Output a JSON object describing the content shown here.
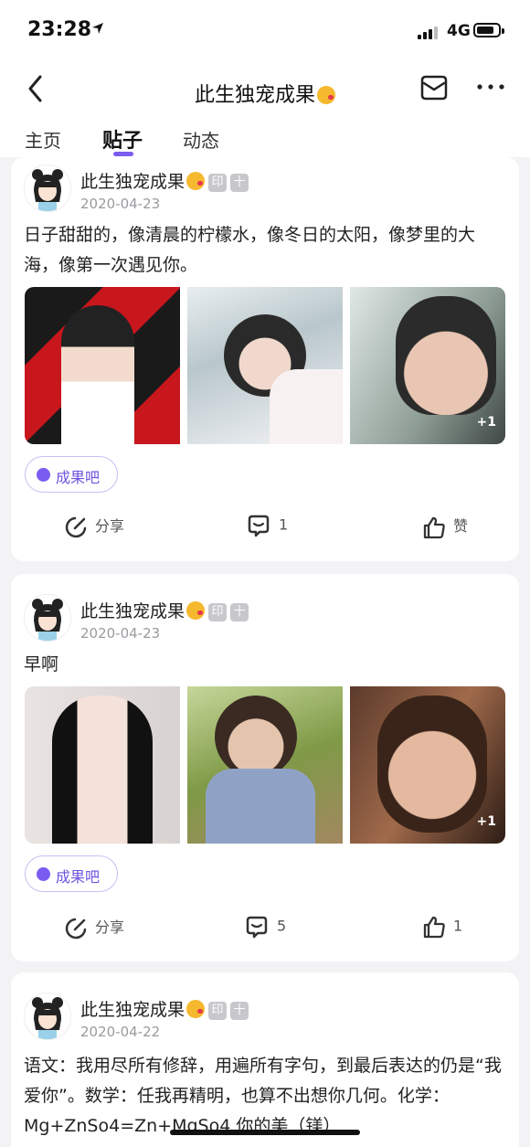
{
  "status": {
    "time": "23:28",
    "network": "4G"
  },
  "nav": {
    "title": "此生独宠成果"
  },
  "tabs": [
    "主页",
    "贴子",
    "动态"
  ],
  "posts": [
    {
      "user": "此生独宠成果",
      "badge1": "印",
      "badge2": "十",
      "date": "2020-04-23",
      "text": "日子甜甜的，像清晨的柠檬水，像冬日的太阳，像梦里的大海，像第一次遇见你。",
      "more_photos": "+1",
      "tag": "成果吧",
      "share": "分享",
      "comments": "1",
      "likes": "赞"
    },
    {
      "user": "此生独宠成果",
      "badge1": "印",
      "badge2": "十",
      "date": "2020-04-23",
      "text": "早啊",
      "more_photos": "+1",
      "tag": "成果吧",
      "share": "分享",
      "comments": "5",
      "likes": "1"
    },
    {
      "user": "此生独宠成果",
      "badge1": "印",
      "badge2": "十",
      "date": "2020-04-22",
      "text": "语文：我用尽所有修辞，用遍所有字句，到最后表达的仍是“我爱你”。数学：任我再精明，也算不出想你几何。化学：Mg+ZnSo4=Zn+MgSo4 你的美（镁）"
    }
  ],
  "colors": {
    "accent": "#7a5cf0"
  }
}
